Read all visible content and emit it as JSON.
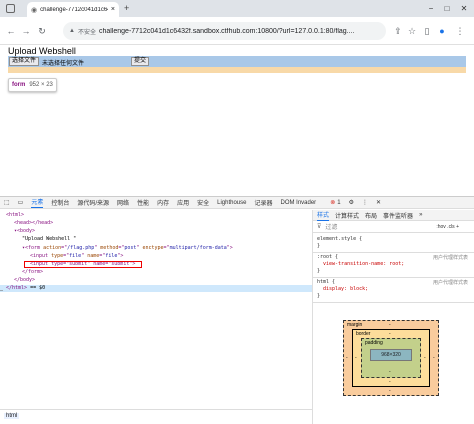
{
  "browser": {
    "tab_title": "challenge-7712c041d1c6432f.",
    "security_label": "不安全",
    "url": "challenge-7712c041d1c6432f.sandbox.ctfhub.com:10800/?url=127.0.0.1:80/flag....",
    "window_controls": [
      "−",
      "□",
      "✕"
    ]
  },
  "page": {
    "title": "Upload Webshell",
    "file_button": "选择文件",
    "file_status": "未选择任何文件",
    "submit_button": "提交",
    "tooltip_tag": "form",
    "tooltip_dims": "952 × 23"
  },
  "devtools": {
    "tabs": [
      "元素",
      "控制台",
      "源代码/来源",
      "网络",
      "性能",
      "内存",
      "应用",
      "安全",
      "Lighthouse",
      "记录器",
      "DOM Invader"
    ],
    "error_count": "1",
    "elements": [
      {
        "indent": 0,
        "parts": [
          [
            "tagc",
            "<html>"
          ]
        ]
      },
      {
        "indent": 1,
        "parts": [
          [
            "tagc",
            "<head></head>"
          ]
        ]
      },
      {
        "indent": 1,
        "parts": [
          [
            "tagc",
            "▾<body>"
          ]
        ]
      },
      {
        "indent": 2,
        "parts": [
          [
            "txt",
            "\"Upload Webshell \""
          ]
        ]
      },
      {
        "indent": 2,
        "parts": [
          [
            "tagc",
            "▾<form "
          ],
          [
            "attr",
            "action"
          ],
          [
            "tagc",
            "=\""
          ],
          [
            "val",
            "/flag.php"
          ],
          [
            "tagc",
            "\" "
          ],
          [
            "attr",
            "method"
          ],
          [
            "tagc",
            "=\""
          ],
          [
            "val",
            "post"
          ],
          [
            "tagc",
            "\" "
          ],
          [
            "attr",
            "enctype"
          ],
          [
            "tagc",
            "=\""
          ],
          [
            "val",
            "multipart/form-data"
          ],
          [
            "tagc",
            "\">"
          ]
        ]
      },
      {
        "indent": 3,
        "parts": [
          [
            "tagc",
            "<input "
          ],
          [
            "attr",
            "type"
          ],
          [
            "tagc",
            "=\""
          ],
          [
            "val",
            "file"
          ],
          [
            "tagc",
            "\" "
          ],
          [
            "attr",
            "name"
          ],
          [
            "tagc",
            "=\""
          ],
          [
            "val",
            "file"
          ],
          [
            "tagc",
            "\">"
          ]
        ]
      },
      {
        "indent": 3,
        "parts": [
          [
            "tagc",
            "<input type=\"submit\" name=\"submit\">"
          ]
        ]
      },
      {
        "indent": 2,
        "parts": [
          [
            "tagc",
            "</form>"
          ]
        ]
      },
      {
        "indent": 1,
        "parts": [
          [
            "tagc",
            "</body>"
          ]
        ]
      },
      {
        "indent": 0,
        "parts": [
          [
            "tagc",
            "</html>"
          ],
          [
            "txt",
            " == $0"
          ]
        ]
      }
    ],
    "breadcrumb": "html",
    "styles_tabs": [
      "样式",
      "计算样式",
      "布局",
      "事件监听器"
    ],
    "filter_placeholder": "过滤",
    "filter_buttons": ":hov  .cls  +",
    "rules": [
      {
        "selector": "element.style {",
        "body": "}",
        "source": ""
      },
      {
        "selector": ":root {",
        "body": "view-transition-name: root;",
        "source": "用户代理样式表"
      },
      {
        "selector": "html {",
        "body": "display: block;",
        "source": "用户代理样式表"
      }
    ],
    "box_model": {
      "margin": "margin",
      "border": "border",
      "padding": "padding",
      "content": "968×320",
      "dash": "-"
    }
  }
}
